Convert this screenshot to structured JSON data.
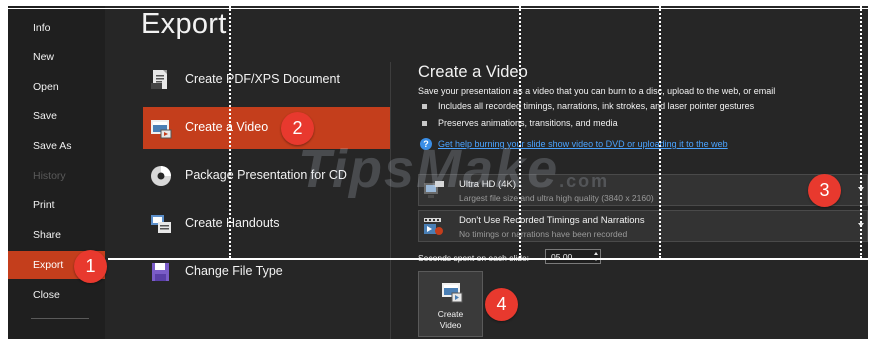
{
  "nav": {
    "items": [
      {
        "label": "Info",
        "state": "normal"
      },
      {
        "label": "New",
        "state": "normal"
      },
      {
        "label": "Open",
        "state": "normal"
      },
      {
        "label": "Save",
        "state": "normal"
      },
      {
        "label": "Save As",
        "state": "normal"
      },
      {
        "label": "History",
        "state": "disabled"
      },
      {
        "label": "Print",
        "state": "normal"
      },
      {
        "label": "Share",
        "state": "normal"
      },
      {
        "label": "Export",
        "state": "selected"
      },
      {
        "label": "Close",
        "state": "normal"
      }
    ]
  },
  "page": {
    "title": "Export"
  },
  "options": [
    {
      "label": "Create PDF/XPS Document",
      "icon": "pdf-document-icon"
    },
    {
      "label": "Create a Video",
      "icon": "video-icon",
      "selected": true
    },
    {
      "label": "Package Presentation for CD",
      "icon": "cd-icon"
    },
    {
      "label": "Create Handouts",
      "icon": "handouts-icon"
    },
    {
      "label": "Change File Type",
      "icon": "file-type-icon"
    }
  ],
  "panel": {
    "title": "Create a Video",
    "description": "Save your presentation as a video that you can burn to a disc, upload to the web, or email",
    "bullets": [
      "Includes all recorded timings, narrations, ink strokes, and laser pointer gestures",
      "Preserves animations, transitions, and media"
    ],
    "help_link": "Get help burning your slide show video to DVD or uploading it to the web",
    "quality_dropdown": {
      "title": "Ultra HD (4K)",
      "subtitle": "Largest file size and ultra high quality (3840 x 2160)"
    },
    "timings_dropdown": {
      "title": "Don't Use Recorded Timings and Narrations",
      "subtitle": "No timings or narrations have been recorded"
    },
    "seconds_label": "Seconds spent on each slide:",
    "seconds_value": "05.00",
    "create_button": "Create\nVideo"
  },
  "callouts": [
    "1",
    "2",
    "3",
    "4"
  ],
  "watermark": {
    "text": "TipsMake",
    "suffix": ".com"
  },
  "colors": {
    "accent": "#c43e1c",
    "background": "#262626",
    "nav": "#1f1f1f",
    "link": "#4aa3ff",
    "callout": "#e8392e"
  }
}
